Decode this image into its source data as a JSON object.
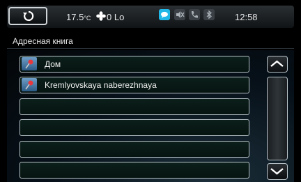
{
  "status": {
    "temperature": "17.5",
    "temperature_unit": "°C",
    "fan_label": "0 Lo",
    "time": "12:58",
    "icons": [
      "back-arrow-icon",
      "fan-icon",
      "chat-icon",
      "mute-icon",
      "phone-icon",
      "bluetooth-icon"
    ],
    "accent_color": "#21b8e8"
  },
  "section_title": "Адресная книга",
  "entries": [
    {
      "label": "Дом",
      "icon": "pin-icon"
    },
    {
      "label": "Kremlyovskaya naberezhnaya",
      "icon": "pin-icon"
    },
    {
      "label": ""
    },
    {
      "label": ""
    },
    {
      "label": ""
    },
    {
      "label": ""
    }
  ],
  "scroll": {
    "up_icon": "chevron-up-icon",
    "down_icon": "chevron-down-icon"
  }
}
